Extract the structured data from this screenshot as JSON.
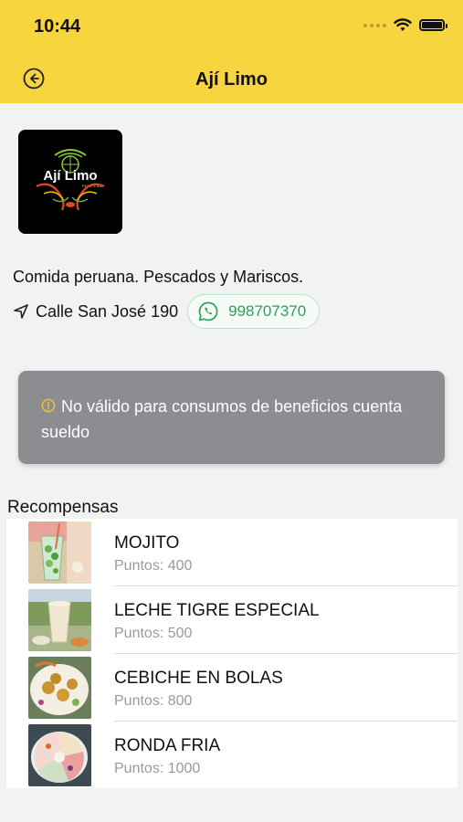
{
  "status_bar": {
    "time": "10:44"
  },
  "header": {
    "title": "Ají Limo"
  },
  "restaurant": {
    "logo_text": "Ají Limo",
    "logo_subtext": "PERÚ & BAR",
    "description": "Comida peruana. Pescados y Mariscos.",
    "address": "Calle San José 190",
    "whatsapp": "998707370"
  },
  "notice": {
    "text": "No válido para consumos de beneficios cuenta sueldo"
  },
  "rewards": {
    "title": "Recompensas",
    "items": [
      {
        "name": "MOJITO",
        "points": "Puntos: 400"
      },
      {
        "name": "LECHE TIGRE ESPECIAL",
        "points": "Puntos: 500"
      },
      {
        "name": "CEBICHE EN BOLAS",
        "points": "Puntos: 800"
      },
      {
        "name": "RONDA FRIA",
        "points": "Puntos: 1000"
      }
    ]
  },
  "colors": {
    "header_bg": "#f7d53e",
    "whatsapp_green": "#2aa35a",
    "notice_bg": "#8c8d91",
    "info_icon": "#f2c830"
  },
  "icons": [
    "back-arrow-icon",
    "navigation-arrow-icon",
    "whatsapp-icon",
    "info-icon",
    "wifi-icon",
    "battery-icon"
  ]
}
